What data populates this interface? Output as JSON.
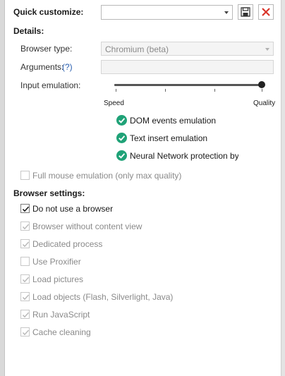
{
  "header": {
    "quick_customize_label": "Quick customize:",
    "quick_customize_value": ""
  },
  "details": {
    "heading": "Details:",
    "browser_type_label": "Browser type:",
    "browser_type_value": "Chromium (beta)",
    "arguments_label": "Arguments:",
    "arguments_help": "(?)",
    "arguments_value": "",
    "input_emulation_label": "Input emulation:",
    "slider_left_label": "Speed",
    "slider_right_label": "Quality",
    "slider_value": 1.0,
    "emulations": [
      {
        "label": "DOM events emulation",
        "checked": true
      },
      {
        "label": "Text insert emulation",
        "checked": true
      },
      {
        "label": "Neural Network protection bypas",
        "checked": true
      }
    ],
    "full_mouse_label": "Full mouse emulation (only max quality)",
    "full_mouse_checked": false
  },
  "browser_settings": {
    "heading": "Browser settings:",
    "items": [
      {
        "label": "Do not use a browser",
        "checked": true,
        "enabled": true
      },
      {
        "label": "Browser without content view",
        "checked": true,
        "enabled": false
      },
      {
        "label": "Dedicated process",
        "checked": true,
        "enabled": false
      },
      {
        "label": "Use Proxifier",
        "checked": false,
        "enabled": false
      },
      {
        "label": "Load pictures",
        "checked": true,
        "enabled": false
      },
      {
        "label": "Load objects (Flash, Silverlight, Java)",
        "checked": true,
        "enabled": false
      },
      {
        "label": "Run JavaScript",
        "checked": true,
        "enabled": false
      },
      {
        "label": "Cache cleaning",
        "checked": true,
        "enabled": false
      }
    ]
  },
  "colors": {
    "accent_green": "#1fa277",
    "close_red": "#d9362b",
    "help_link": "#2a5fb0"
  },
  "icons": {
    "save": "floppy-disk-icon",
    "close": "close-icon"
  }
}
